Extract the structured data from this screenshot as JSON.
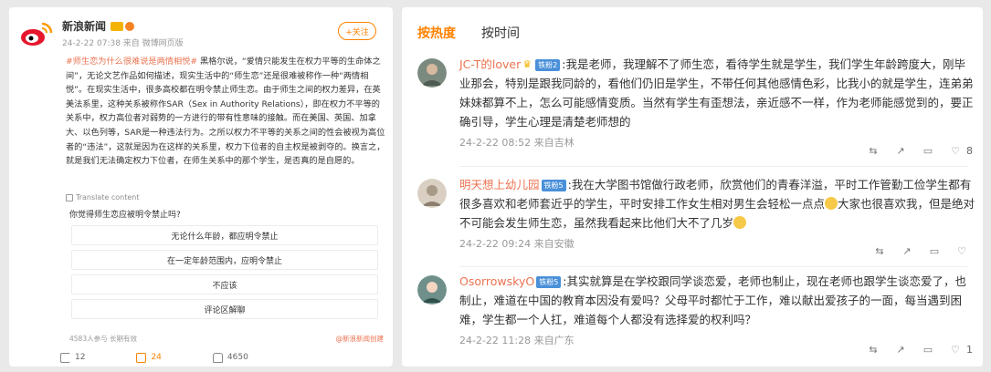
{
  "left": {
    "username": "新浪新闻",
    "meta": "24-2-22 07:38  来自 微博网页版",
    "follow_label": "+关注",
    "hashtag": "#师生恋为什么很难说是两情相悦#",
    "post_body": " 黑格尔说，“爱情只能发生在权力平等的生命体之间”，无论文艺作品如何描述，现实生活中的“师生恋”还是很难被称作一种“两情相悦”。在现实生活中，很多高校都在明令禁止师生恋。由于师生之间的权力差异，在英美法系里，这种关系被称作SAR（Sex in Authority Relations），即在权力不平等的关系中，权力高位者对弱势的一方进行的带有性意味的接触。而在美国、英国、加拿大、以色列等，SAR是一种违法行为。之所以权力不平等的关系之间的性会被视为高位者的“违法”，这就是因为在这样的关系里，权力下位者的自主权是被剥夺的。换言之，就是我们无法确定权力下位者，在师生关系中的那个学生，是否真的是自愿的。",
    "translate_label": "Translate content",
    "poll_question": "你觉得师生恋应被明令禁止吗?",
    "poll_options": [
      "无论什么年龄，都应明令禁止",
      "在一定年龄范围内，应明令禁止",
      "不应该",
      "评论区解聊"
    ],
    "poll_stats": "4583人参与 长期有效",
    "poll_source": "@新浪新闻创建",
    "actions": {
      "share": "12",
      "comment": "24",
      "like": "4650"
    }
  },
  "right": {
    "tabs": [
      "按热度",
      "按时间"
    ],
    "comments": [
      {
        "user": "JC-T的lover",
        "badge": "铁粉2",
        "text": ":我是老师，我理解不了师生恋，看待学生就是学生，我们学生年龄跨度大，刚毕业那会，特别是跟我同龄的，看他们仍旧是学生，不带任何其他感情色彩，比我小的就是学生，连弟弟妹妹都算不上，怎么可能感情变质。当然有学生有歪想法，亲近感不一样，作为老师能感觉到的，要正确引导，学生心理是清楚老师想的",
        "meta": "24-2-22 08:52 来自吉林",
        "likes": "8"
      },
      {
        "user": "明天想上幼儿园",
        "badge": "铁粉5",
        "text": ":我在大学图书馆做行政老师，欣赏他们的青春洋溢，平时工作管勤工俭学生都有很多喜欢和老师套近乎的学生，平时安排工作女生相对男生会轻松一点点",
        "text2": "大家也很喜欢我，但是绝对不可能会发生师生恋，虽然我看起来比他们大不了几岁",
        "meta": "24-2-22 09:24 来自安徽",
        "likes": ""
      },
      {
        "user": "OsorrowskyO",
        "badge": "铁粉5",
        "text": ":其实就算是在学校跟同学谈恋爱，老师也制止，现在老师也跟学生谈恋爱了，也制止，难道在中国的教育本因没有爱吗？父母平时都忙于工作，难以献出爱孩子的一面，每当遇到困难，学生都一个人扛，难道每个人都没有选择爱的权利吗？",
        "meta": "24-2-22 11:28 来自广东",
        "likes": "1"
      }
    ]
  },
  "colors": {
    "accent": "#ff8200",
    "link": "#eb7350"
  }
}
